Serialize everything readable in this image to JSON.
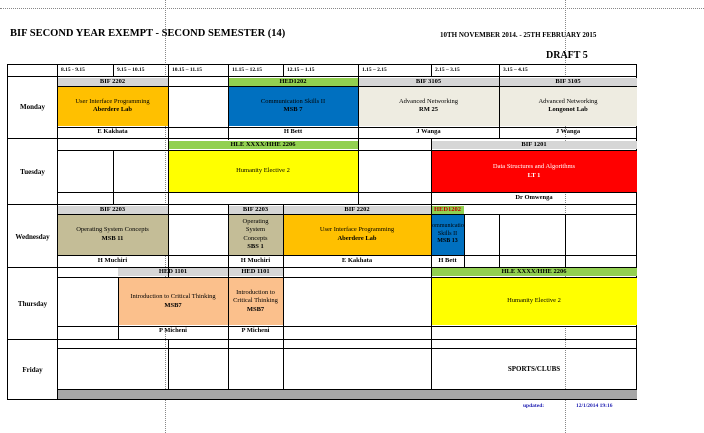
{
  "header": {
    "title": "BIF SECOND YEAR EXEMPT - SECOND SEMESTER (14)",
    "dates": "10TH NOVEMBER 2014. - 25TH FEBRUARY 2015",
    "draft": "DRAFT 5"
  },
  "times": [
    "8.15 - 9.15",
    "9.15 – 10.15",
    "10.15 – 11.15",
    "11.15 – 12.15",
    "12.15 – 1.15",
    "1.15 – 2.15",
    "2.15 – 3.15",
    "3.15 – 4.15"
  ],
  "days": [
    "Monday",
    "Tuesday",
    "Wednesday",
    "Thursday",
    "Friday"
  ],
  "monday": {
    "bif2202_code": "BIF 2202",
    "ui_course": "User Interface Programming",
    "ui_room": "Aberdere Lab",
    "ui_lecturer": "E Kakhata",
    "hed1202_code": "HED1202",
    "comm_course": "Communication Skills II",
    "comm_room": "MSB 7",
    "comm_lecturer": "H Bett",
    "bif3105a_code": "BIF 3105",
    "net_course_a": "Advanced Networking",
    "net_room_a": "RM 25",
    "net_lecturer_a": "J Wanga",
    "bif3105b_code": "BIF 3105",
    "net_course_b": "Advanced Networking",
    "net_room_b": "Longonot  Lab",
    "net_lecturer_b": "J Wanga"
  },
  "tuesday": {
    "hle_code": "HLE XXXX/HHE 2206",
    "hle_course": "Humanity Elective 2",
    "bif1201_code": "BIF 1201",
    "dsa_course": "Data Structures and Algorithms",
    "dsa_room": "LT 1",
    "dsa_lecturer": "Dr Omwenga"
  },
  "wednesday": {
    "bif2203_code": "BIF 2203",
    "os_course": "Operating System Concepts",
    "os_room": "MSB 11",
    "os_lecturer": "H Muchiri",
    "bif2203b_code": "BIF 2203",
    "os2_course": "Operating System Concepts",
    "os2_room": "SBS 1",
    "os2_lecturer": "H Muchiri",
    "bif2202_code": "BIF 2202",
    "ui_course": "User Interface Programming",
    "ui_room": "Aberdere Lab",
    "ui_lecturer": "E Kakhata",
    "hed1202_code": "HED1202",
    "comm_course": "Communication Skills II",
    "comm_room": "MSB 13",
    "comm_lecturer": "H Bett"
  },
  "thursday": {
    "hed1101_code": "HED 1101",
    "ct_course": "Introduction to Critical Thinking",
    "ct_room": "MSB7",
    "ct_lecturer": "P Micheni",
    "hed1101b_code": "HED 1101",
    "ct2_course": "Introduction to Critical Thinking",
    "ct2_room": "MSB7",
    "ct2_lecturer": "P Micheni",
    "hle_code": "HLE XXXX/HHE 2206",
    "hle_course": "Humanity Elective 2"
  },
  "friday": {
    "sports": "SPORTS/CLUBS"
  },
  "footer": {
    "updated_label": "updated:",
    "updated_value": "12/1/2014 19:16"
  },
  "colors": {
    "header_grey": "#d6d6d6",
    "orange": "#ffc000",
    "blue": "#0070c0",
    "light_grey": "#eeece1",
    "green": "#92d050",
    "yellow": "#ffff00",
    "red": "#ff0000",
    "tan": "#c4bd97",
    "peach": "#fbc08c",
    "footer_grey": "#a6a6a6"
  }
}
